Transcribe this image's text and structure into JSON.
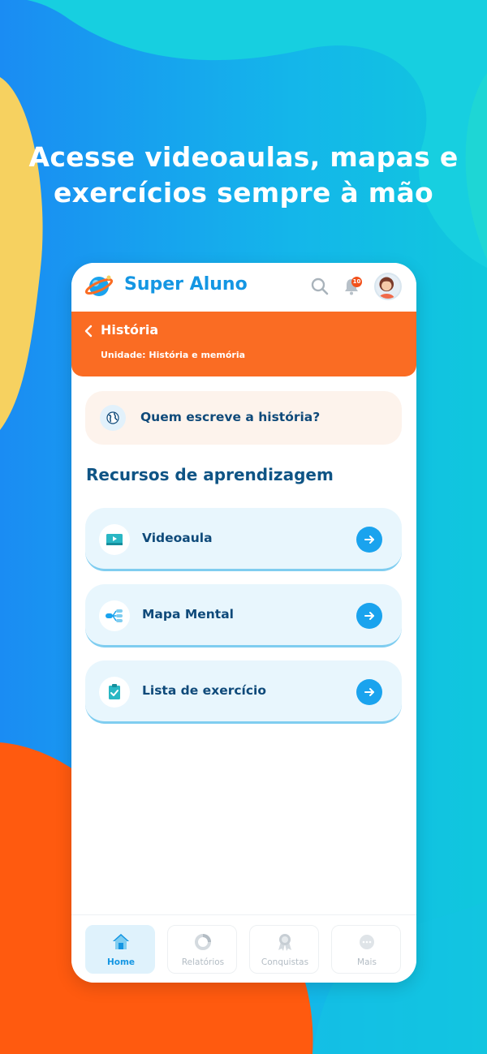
{
  "headline": {
    "line1": "Acesse videoaulas, mapas e",
    "line2": "exercícios sempre à mão"
  },
  "app": {
    "title": "Super Aluno",
    "notification_count": "10",
    "icons": {
      "logo": "planet-logo",
      "search": "search-icon",
      "notifications": "bell-icon",
      "avatar": "user-avatar"
    }
  },
  "subject": {
    "title": "História",
    "unit": "Unidade: História e memória"
  },
  "topic": {
    "label": "Quem escreve a história?",
    "icon": "globe-icon"
  },
  "resources": {
    "section_title": "Recursos de aprendizagem",
    "items": [
      {
        "label": "Videoaula",
        "icon": "video-icon"
      },
      {
        "label": "Mapa Mental",
        "icon": "mind-map-icon"
      },
      {
        "label": "Lista de exercício",
        "icon": "checklist-icon"
      }
    ]
  },
  "bottom_nav": {
    "items": [
      {
        "label": "Home",
        "icon": "home-icon",
        "active": true
      },
      {
        "label": "Relatórios",
        "icon": "chart-ring-icon",
        "active": false
      },
      {
        "label": "Conquistas",
        "icon": "medal-icon",
        "active": false
      },
      {
        "label": "Mais",
        "icon": "more-icon",
        "active": false
      }
    ]
  },
  "colors": {
    "brand_blue": "#1496e3",
    "header_orange": "#fa6c23",
    "background_blue": "#1b8ff0",
    "blob_yellow": "#f6d160",
    "blob_cyan": "#18d3d4",
    "blob_orange": "#ff5a0f"
  }
}
